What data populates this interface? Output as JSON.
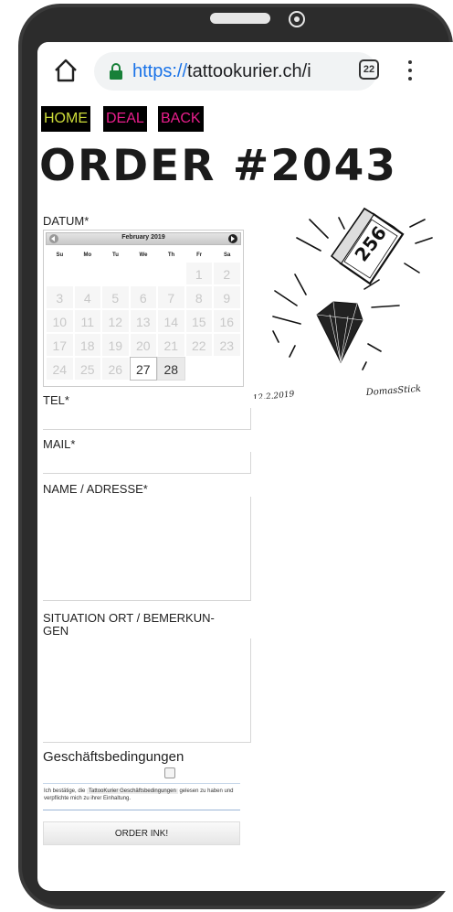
{
  "browser": {
    "url_scheme": "https://",
    "url_host": "tattookurier.ch/i",
    "tab_count": "22",
    "icons": {
      "home": "home-icon",
      "lock": "lock-icon",
      "tabs": "tabs-count-icon",
      "menu": "overflow-menu-icon"
    }
  },
  "nav": {
    "home": "HOME",
    "deal": "DEAL",
    "back": "BACK"
  },
  "page": {
    "title": "ORDER #2043"
  },
  "form": {
    "datum_label": "DATUM*",
    "tel_label": "TEL*",
    "mail_label": "MAIL*",
    "name_label": "NAME / ADRESSE*",
    "situation_label_line1": "SITUATION ORT / BEMERKUN-",
    "situation_label_line2": "GEN",
    "terms_label": "Geschäftsbedingungen",
    "terms_text_before": "Ich bestätige, die",
    "terms_link": "TattooKurier Geschäftsbedingungen",
    "terms_text_after": "gelesen zu haben und verpflichte mich zu ihrer Einhaltung.",
    "order_button": "ORDER INK!"
  },
  "calendar": {
    "month": "February 2019",
    "weekdays": [
      "Su",
      "Mo",
      "Tu",
      "We",
      "Th",
      "Fr",
      "Sa"
    ],
    "leading_blanks": 5,
    "days": [
      "1",
      "2",
      "3",
      "4",
      "5",
      "6",
      "7",
      "8",
      "9",
      "10",
      "11",
      "12",
      "13",
      "14",
      "15",
      "16",
      "17",
      "18",
      "19",
      "20",
      "21",
      "22",
      "23",
      "24",
      "25",
      "26",
      "27",
      "28"
    ],
    "selectable_days": [
      "27",
      "28"
    ],
    "selected_day": "27"
  },
  "illustration": {
    "box_number": "256",
    "date_signature": "12.2.2019",
    "artist_signature": "DomasStick"
  }
}
